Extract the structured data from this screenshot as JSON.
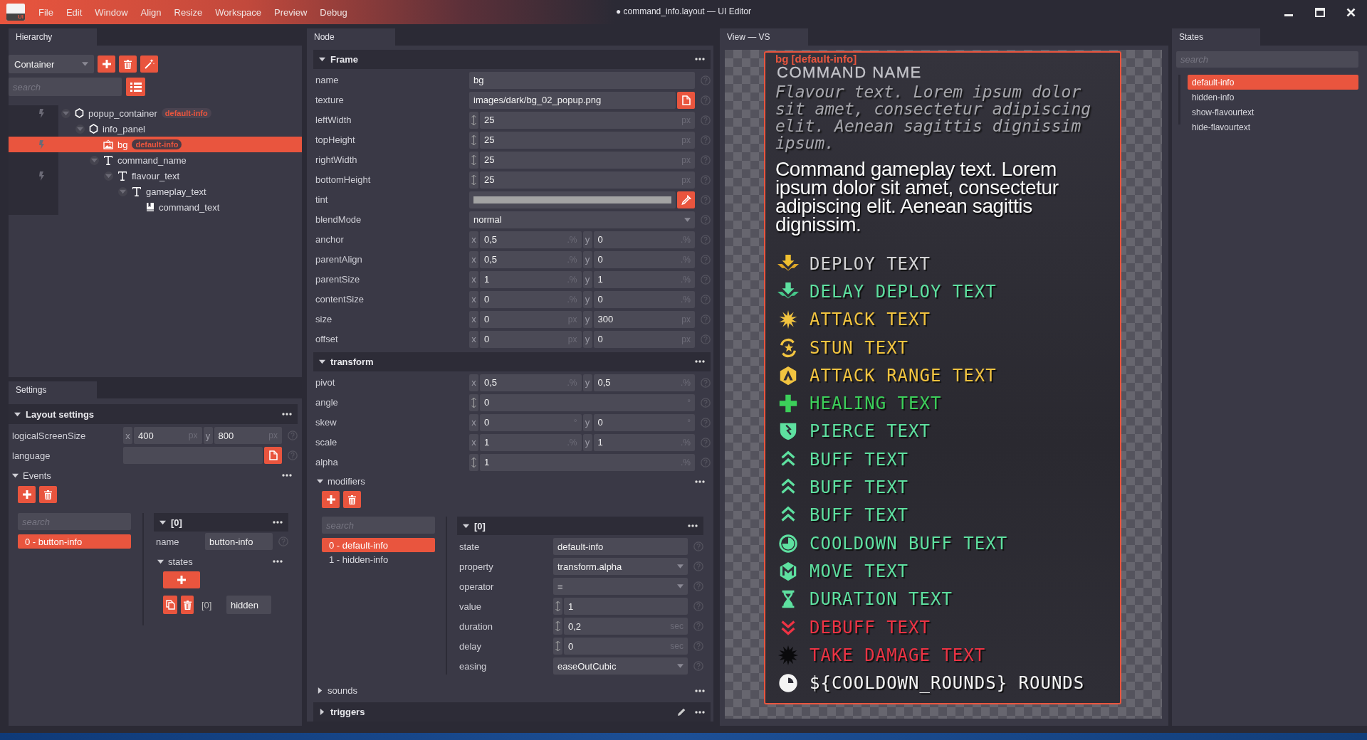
{
  "app": {
    "logo": "UI",
    "menu": [
      "File",
      "Edit",
      "Window",
      "Align",
      "Resize",
      "Workspace",
      "Preview",
      "Debug"
    ],
    "title": "● command_info.layout — UI Editor"
  },
  "hierarchy": {
    "tab": "Hierarchy",
    "node_type": "Container",
    "search": {
      "placeholder": "search"
    },
    "tree": [
      {
        "name": "popup_container",
        "kind": "container",
        "badge": "default-info",
        "event": true,
        "expanded": true,
        "selected": false,
        "children": [
          {
            "name": "info_panel",
            "kind": "container",
            "event": false,
            "expanded": true,
            "selected": false,
            "children": [
              {
                "name": "bg",
                "kind": "image",
                "badge": "default-info",
                "event": true,
                "selected": true
              },
              {
                "name": "command_name",
                "kind": "text",
                "event": false,
                "expanded": true,
                "selected": false,
                "children": [
                  {
                    "name": "flavour_text",
                    "kind": "text",
                    "event": true,
                    "expanded": true,
                    "selected": false,
                    "children": [
                      {
                        "name": "gameplay_text",
                        "kind": "text",
                        "event": false,
                        "expanded": true,
                        "selected": false,
                        "children": [
                          {
                            "name": "command_text",
                            "kind": "label",
                            "event": false,
                            "selected": false
                          }
                        ]
                      }
                    ]
                  }
                ]
              }
            ]
          }
        ]
      }
    ]
  },
  "settings": {
    "tab": "Settings",
    "section": {
      "title": "Layout settings",
      "expanded": true,
      "rows": [
        {
          "kind": "xy",
          "label": "logicalScreenSize",
          "fields": [
            {
              "axis": "x",
              "value": "400",
              "unit": "px"
            },
            {
              "axis": "y",
              "value": "800",
              "unit": "px"
            }
          ]
        },
        {
          "kind": "file",
          "label": "language"
        }
      ]
    },
    "events": {
      "title": "Events",
      "expanded": true,
      "search": {
        "placeholder": "search"
      },
      "items": [
        {
          "label": "0 - button-info",
          "selected": true
        }
      ],
      "detail": {
        "title": "[0]",
        "expanded": true,
        "rows": [
          {
            "kind": "text",
            "label": "name",
            "value": "button-info"
          }
        ],
        "states": {
          "title": "states",
          "expanded": true,
          "items": [
            {
              "index": "[0]",
              "value": "hidden"
            }
          ]
        }
      }
    }
  },
  "node": {
    "tab": "Node",
    "sections": [
      {
        "kind": "band",
        "title": "Frame",
        "expanded": true,
        "rows": [
          {
            "kind": "text",
            "label": "name",
            "value": "bg"
          },
          {
            "kind": "file",
            "label": "texture",
            "value": "images/dark/bg_02_popup.png"
          },
          {
            "kind": "spin",
            "label": "leftWidth",
            "value": "25",
            "unit": "px"
          },
          {
            "kind": "spin",
            "label": "topHeight",
            "value": "25",
            "unit": "px"
          },
          {
            "kind": "spin",
            "label": "rightWidth",
            "value": "25",
            "unit": "px"
          },
          {
            "kind": "spin",
            "label": "bottomHeight",
            "value": "25",
            "unit": "px"
          },
          {
            "kind": "color",
            "label": "tint",
            "color": "#a3a3a3"
          },
          {
            "kind": "select",
            "label": "blendMode",
            "value": "normal"
          },
          {
            "kind": "xy",
            "label": "anchor",
            "fields": [
              {
                "axis": "x",
                "value": "0,5",
                "unit": ".%"
              },
              {
                "axis": "y",
                "value": "0",
                "unit": ".%"
              }
            ]
          },
          {
            "kind": "xy",
            "label": "parentAlign",
            "fields": [
              {
                "axis": "x",
                "value": "0,5",
                "unit": ".%"
              },
              {
                "axis": "y",
                "value": "0",
                "unit": ".%"
              }
            ]
          },
          {
            "kind": "xy",
            "label": "parentSize",
            "fields": [
              {
                "axis": "x",
                "value": "1",
                "unit": ".%"
              },
              {
                "axis": "y",
                "value": "1",
                "unit": ".%"
              }
            ]
          },
          {
            "kind": "xy",
            "label": "contentSize",
            "fields": [
              {
                "axis": "x",
                "value": "0",
                "unit": ".%"
              },
              {
                "axis": "y",
                "value": "0",
                "unit": ".%"
              }
            ]
          },
          {
            "kind": "xy",
            "label": "size",
            "fields": [
              {
                "axis": "x",
                "value": "0",
                "unit": "px"
              },
              {
                "axis": "y",
                "value": "300",
                "unit": "px"
              }
            ]
          },
          {
            "kind": "xy",
            "label": "offset",
            "fields": [
              {
                "axis": "x",
                "value": "0",
                "unit": "px"
              },
              {
                "axis": "y",
                "value": "0",
                "unit": "px"
              }
            ]
          }
        ]
      },
      {
        "kind": "band",
        "title": "transform",
        "expanded": true,
        "rows": [
          {
            "kind": "xy",
            "label": "pivot",
            "fields": [
              {
                "axis": "x",
                "value": "0,5",
                "unit": ".%"
              },
              {
                "axis": "y",
                "value": "0,5",
                "unit": ".%"
              }
            ]
          },
          {
            "kind": "spin",
            "label": "angle",
            "value": "0",
            "unit": "°"
          },
          {
            "kind": "xy",
            "label": "skew",
            "fields": [
              {
                "axis": "x",
                "value": "0",
                "unit": "°"
              },
              {
                "axis": "y",
                "value": "0",
                "unit": "°"
              }
            ]
          },
          {
            "kind": "xy",
            "label": "scale",
            "fields": [
              {
                "axis": "x",
                "value": "1",
                "unit": ".%"
              },
              {
                "axis": "y",
                "value": "1",
                "unit": ".%"
              }
            ]
          },
          {
            "kind": "spin",
            "label": "alpha",
            "value": "1",
            "unit": ".%"
          }
        ]
      },
      {
        "kind": "list",
        "title": "modifiers",
        "expanded": true,
        "search": {
          "placeholder": "search"
        },
        "items": [
          {
            "label": "0 - default-info",
            "selected": true
          },
          {
            "label": "1 - hidden-info",
            "selected": false
          }
        ],
        "detail": {
          "title": "[0]",
          "expanded": true,
          "rows": [
            {
              "kind": "text",
              "label": "state",
              "value": "default-info"
            },
            {
              "kind": "select",
              "label": "property",
              "value": "transform.alpha"
            },
            {
              "kind": "select",
              "label": "operator",
              "value": "="
            },
            {
              "kind": "spin",
              "label": "value",
              "value": "1"
            },
            {
              "kind": "spin",
              "label": "duration",
              "value": "0,2",
              "unit": "sec"
            },
            {
              "kind": "spin",
              "label": "delay",
              "value": "0",
              "unit": "sec"
            },
            {
              "kind": "select",
              "label": "easing",
              "value": "easeOutCubic"
            }
          ]
        }
      },
      {
        "kind": "plain",
        "title": "sounds",
        "expanded": false
      },
      {
        "kind": "band",
        "title": "triggers",
        "expanded": false,
        "editable": true
      }
    ]
  },
  "view": {
    "tab": "View — VS",
    "selection_label": "bg [default-info]",
    "card": {
      "title": "COMMAND NAME",
      "flavour": "Flavour text. Lorem ipsum dolor sit amet, consectetur adipiscing elit. Aenean sagittis dignissim ipsum.",
      "gameplay": "Command gameplay text. Lorem ipsum dolor sit amet, consectetur adipiscing elit. Aenean sagittis dignissim.",
      "effects": [
        {
          "kind": "deploy",
          "text": "DEPLOY TEXT",
          "color": "#d4d4d6"
        },
        {
          "kind": "delay-deploy",
          "text": "DELAY DEPLOY TEXT",
          "color": "#5ee0a0"
        },
        {
          "kind": "attack",
          "text": "ATTACK TEXT",
          "color": "#f2c440"
        },
        {
          "kind": "stun",
          "text": "STUN TEXT",
          "color": "#f2c440"
        },
        {
          "kind": "attack-range",
          "text": "ATTACK RANGE TEXT",
          "color": "#f2c440"
        },
        {
          "kind": "healing",
          "text": "HEALING TEXT",
          "color": "#3ccf5a"
        },
        {
          "kind": "pierce",
          "text": "PIERCE TEXT",
          "color": "#5ee0a0"
        },
        {
          "kind": "buff",
          "text": "BUFF TEXT",
          "color": "#5ee0a0"
        },
        {
          "kind": "buff",
          "text": "BUFF TEXT",
          "color": "#5ee0a0"
        },
        {
          "kind": "buff",
          "text": "BUFF TEXT",
          "color": "#5ee0a0"
        },
        {
          "kind": "cooldown-buff",
          "text": "COOLDOWN BUFF TEXT",
          "color": "#5ee0a0"
        },
        {
          "kind": "move",
          "text": "MOVE TEXT",
          "color": "#5ee0a0"
        },
        {
          "kind": "duration",
          "text": "DURATION TEXT",
          "color": "#5ee0a0"
        },
        {
          "kind": "debuff",
          "text": "DEBUFF TEXT",
          "color": "#ee3344"
        },
        {
          "kind": "take-damage",
          "text": "TAKE DAMAGE TEXT",
          "color": "#ee3344"
        },
        {
          "kind": "cooldown",
          "text": "${COOLDOWN_ROUNDS} ROUNDS",
          "color": "#f4f4f4"
        }
      ]
    }
  },
  "states": {
    "tab": "States",
    "search": {
      "placeholder": "search"
    },
    "items": [
      {
        "label": "default-info",
        "selected": true
      },
      {
        "label": "hidden-info",
        "selected": false
      },
      {
        "label": "show-flavourtext",
        "selected": false
      },
      {
        "label": "hide-flavourtext",
        "selected": false
      }
    ]
  }
}
